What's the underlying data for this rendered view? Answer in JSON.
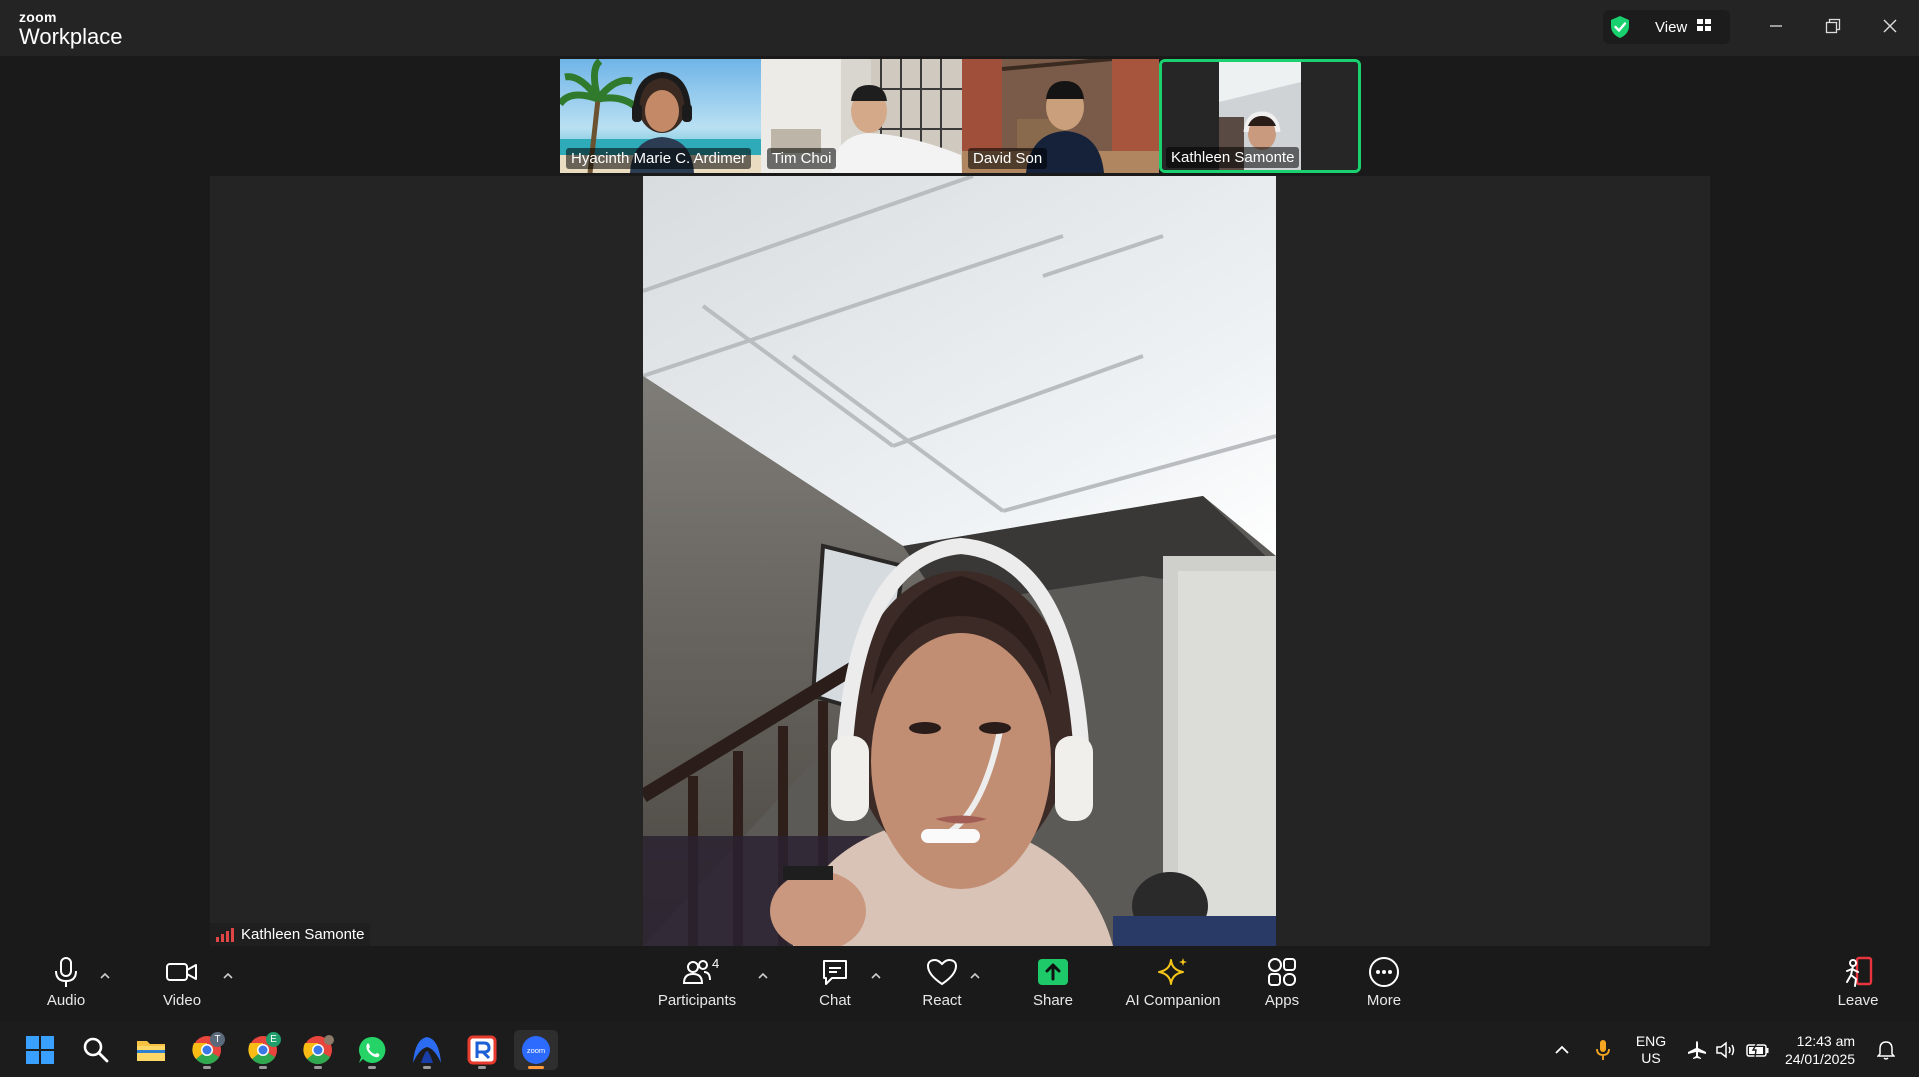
{
  "app": {
    "brand_small": "zoom",
    "brand_large": "Workplace",
    "view_label": "View"
  },
  "thumbnails": [
    {
      "name": "Hyacinth Marie C. Ardimer"
    },
    {
      "name": "Tim Choi"
    },
    {
      "name": "David Son"
    },
    {
      "name": "Kathleen Samonte"
    }
  ],
  "active_speaker": {
    "name": "Kathleen Samonte"
  },
  "toolbar": {
    "audio": "Audio",
    "video": "Video",
    "participants": "Participants",
    "participants_count": "4",
    "chat": "Chat",
    "react": "React",
    "share": "Share",
    "ai_companion": "AI Companion",
    "apps": "Apps",
    "more": "More",
    "leave": "Leave"
  },
  "taskbar": {
    "lang_line1": "ENG",
    "lang_line2": "US",
    "time": "12:43 am",
    "date": "24/01/2025",
    "chrome_badges": [
      "T",
      "E"
    ]
  },
  "colors": {
    "accent_green": "#19d16f",
    "share_green": "#1ec96a",
    "ai_yellow": "#f5c518",
    "leave_red": "#e8343c",
    "zoom_blue": "#2d6bff"
  }
}
